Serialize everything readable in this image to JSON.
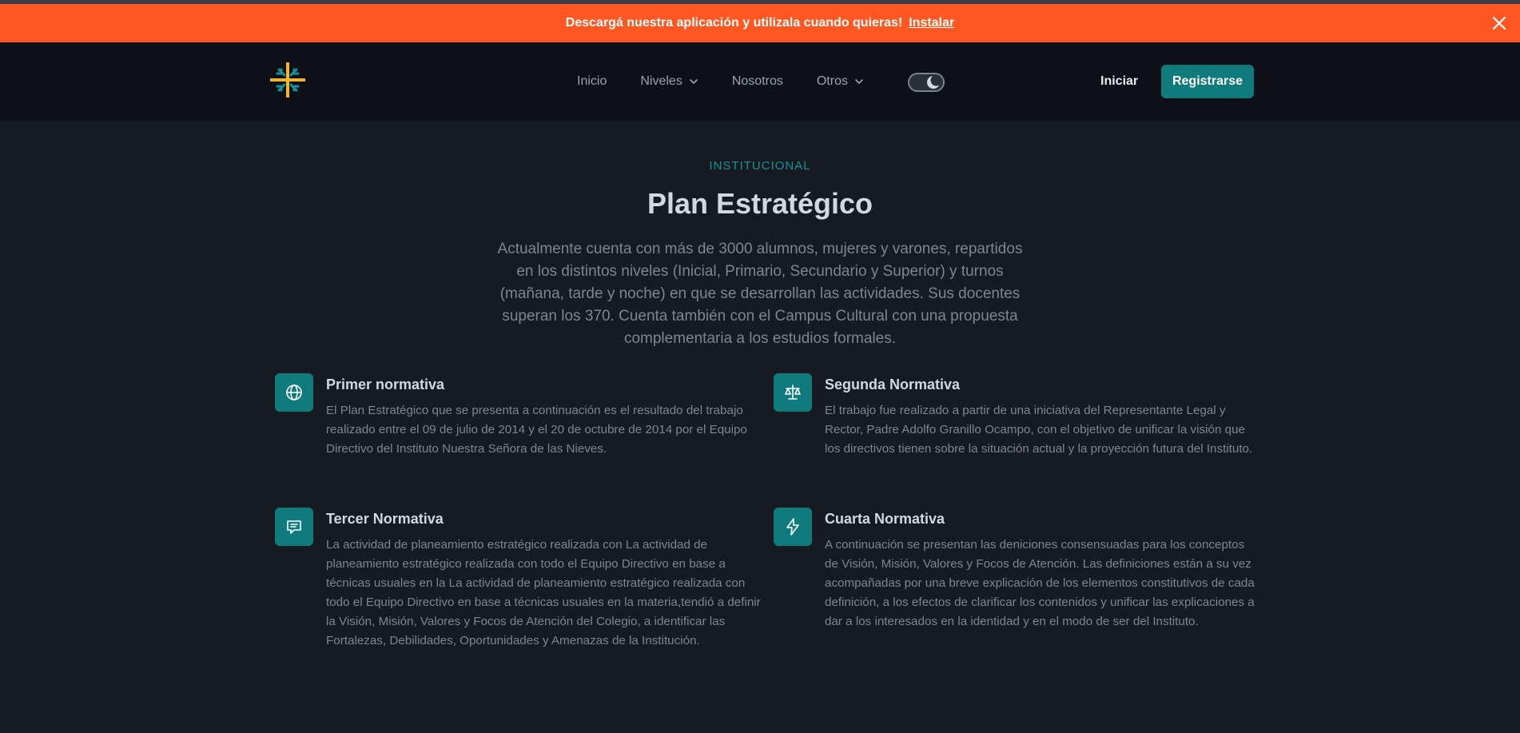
{
  "banner": {
    "message": "Descargá nuestra aplicación y utilizala cuando quieras!",
    "install_label": "Instalar"
  },
  "nav": {
    "links": [
      {
        "label": "Inicio",
        "icon": null
      },
      {
        "label": "Niveles",
        "icon": "chevron-down-icon"
      },
      {
        "label": "Nosotros",
        "icon": null
      },
      {
        "label": "Otros",
        "icon": "chevron-down-icon"
      }
    ],
    "login_label": "Iniciar",
    "register_label": "Registrarse"
  },
  "hero": {
    "eyebrow": "INSTITUCIONAL",
    "title": "Plan Estratégico",
    "lead": "Actualmente cuenta con más de 3000 alumnos, mujeres y varones, repartidos en los distintos niveles (Inicial, Primario, Secundario y Superior) y turnos (mañana, tarde y noche) en que se desarrollan las actividades. Sus docentes superan los 370. Cuenta también con el Campus Cultural con una propuesta complementaria a los estudios formales."
  },
  "features": [
    {
      "icon": "globe-icon",
      "title": "Primer normativa",
      "text": "El Plan Estratégico que se presenta a continuación es el resultado del trabajo realizado entre el 09 de julio de 2014 y el 20 de octubre de 2014 por el Equipo Directivo del Instituto Nuestra Señora de las Nieves."
    },
    {
      "icon": "scale-icon",
      "title": "Segunda Normativa",
      "text": "El trabajo fue realizado a partir de una iniciativa del Representante Legal y Rector, Padre Adolfo Granillo Ocampo, con el objetivo de unificar la visión que los directivos tienen sobre la situación actual y la proyección futura del Instituto."
    },
    {
      "icon": "chat-icon",
      "title": "Tercer Normativa",
      "text": "La actividad de planeamiento estratégico realizada con La actividad de planeamiento estratégico realizada con todo el Equipo Directivo en base a técnicas usuales en la La actividad de planeamiento estratégico realizada con todo el Equipo Directivo en base a técnicas usuales en la materia,tendió a definir la Visión, Misión, Valores y Focos de Atención del Colegio, a identificar las Fortalezas, Debilidades, Oportunidades y Amenazas de la Institución."
    },
    {
      "icon": "lightning-icon",
      "title": "Cuarta Normativa",
      "text": "A continuación se presentan las deniciones consensuadas para los conceptos de Visión, Misión, Valores y Focos de Atención. Las definiciones están a su vez acompañadas por una breve explicación de los elementos constitutivos de cada definición, a los efectos de clarificar los contenidos y unificar las explicaciones a dar a los interesados en la identidad y en el modo de ser del Instituto."
    }
  ],
  "colors": {
    "banner": "#ff5722",
    "accent": "#0f7b7d",
    "eyebrow": "#169296",
    "background": "#161b22",
    "navbar": "#0d1016"
  }
}
